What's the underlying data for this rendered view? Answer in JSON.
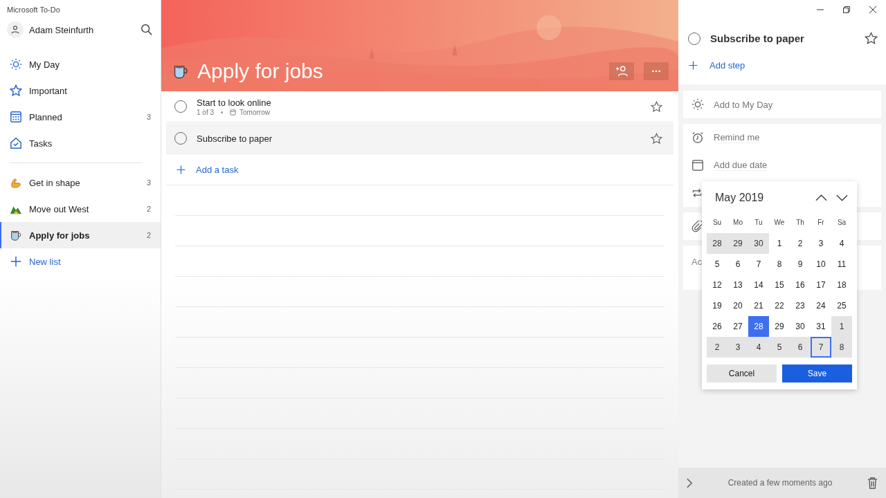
{
  "window": {
    "title": "Microsoft To-Do"
  },
  "user": {
    "name": "Adam Steinfurth"
  },
  "smart_lists": [
    {
      "kind": "sun",
      "label": "My Day",
      "selected": false
    },
    {
      "kind": "star",
      "label": "Important",
      "selected": false
    },
    {
      "kind": "calendar",
      "label": "Planned",
      "count": "3",
      "selected": false
    },
    {
      "kind": "home",
      "label": "Tasks",
      "selected": false
    }
  ],
  "lists": [
    {
      "kind": "arm",
      "label": "Get in shape",
      "count": "3",
      "selected": false
    },
    {
      "kind": "mountain",
      "label": "Move out West",
      "count": "2",
      "selected": false
    },
    {
      "kind": "mug",
      "label": "Apply for jobs",
      "count": "2",
      "selected": true
    }
  ],
  "new_list": "New list",
  "list_title": "Apply for jobs",
  "tasks": [
    {
      "title": "Start to look online",
      "steps": "1 of 3",
      "due": "Tomorrow",
      "completed": false,
      "selected": false
    },
    {
      "title": "Subscribe to paper",
      "completed": false,
      "selected": true
    }
  ],
  "add_task": "Add a task",
  "detail": {
    "title": "Subscribe to paper",
    "completed": false,
    "add_step": "Add step",
    "my_day": "Add to My Day",
    "remind": "Remind me",
    "due_date": "Add due date",
    "note_fragment": "Ac",
    "footer": "Created a few moments ago"
  },
  "calendar": {
    "month": "May 2019",
    "weekdays": [
      "Su",
      "Mo",
      "Tu",
      "We",
      "Th",
      "Fr",
      "Sa"
    ],
    "days": [
      {
        "label": "28",
        "muted": true,
        "selected": false,
        "focused": false
      },
      {
        "label": "29",
        "muted": true,
        "selected": false,
        "focused": false
      },
      {
        "label": "30",
        "muted": true,
        "selected": false,
        "focused": false
      },
      {
        "label": "1",
        "muted": false,
        "selected": false,
        "focused": false
      },
      {
        "label": "2",
        "muted": false,
        "selected": false,
        "focused": false
      },
      {
        "label": "3",
        "muted": false,
        "selected": false,
        "focused": false
      },
      {
        "label": "4",
        "muted": false,
        "selected": false,
        "focused": false
      },
      {
        "label": "5",
        "muted": false,
        "selected": false,
        "focused": false
      },
      {
        "label": "6",
        "muted": false,
        "selected": false,
        "focused": false
      },
      {
        "label": "7",
        "muted": false,
        "selected": false,
        "focused": false
      },
      {
        "label": "8",
        "muted": false,
        "selected": false,
        "focused": false
      },
      {
        "label": "9",
        "muted": false,
        "selected": false,
        "focused": false
      },
      {
        "label": "10",
        "muted": false,
        "selected": false,
        "focused": false
      },
      {
        "label": "11",
        "muted": false,
        "selected": false,
        "focused": false
      },
      {
        "label": "12",
        "muted": false,
        "selected": false,
        "focused": false
      },
      {
        "label": "13",
        "muted": false,
        "selected": false,
        "focused": false
      },
      {
        "label": "14",
        "muted": false,
        "selected": false,
        "focused": false
      },
      {
        "label": "15",
        "muted": false,
        "selected": false,
        "focused": false
      },
      {
        "label": "16",
        "muted": false,
        "selected": false,
        "focused": false
      },
      {
        "label": "17",
        "muted": false,
        "selected": false,
        "focused": false
      },
      {
        "label": "18",
        "muted": false,
        "selected": false,
        "focused": false
      },
      {
        "label": "19",
        "muted": false,
        "selected": false,
        "focused": false
      },
      {
        "label": "20",
        "muted": false,
        "selected": false,
        "focused": false
      },
      {
        "label": "21",
        "muted": false,
        "selected": false,
        "focused": false
      },
      {
        "label": "22",
        "muted": false,
        "selected": false,
        "focused": false
      },
      {
        "label": "23",
        "muted": false,
        "selected": false,
        "focused": false
      },
      {
        "label": "24",
        "muted": false,
        "selected": false,
        "focused": false
      },
      {
        "label": "25",
        "muted": false,
        "selected": false,
        "focused": false
      },
      {
        "label": "26",
        "muted": false,
        "selected": false,
        "focused": false
      },
      {
        "label": "27",
        "muted": false,
        "selected": false,
        "focused": false
      },
      {
        "label": "28",
        "muted": false,
        "selected": true,
        "focused": false
      },
      {
        "label": "29",
        "muted": false,
        "selected": false,
        "focused": false
      },
      {
        "label": "30",
        "muted": false,
        "selected": false,
        "focused": false
      },
      {
        "label": "31",
        "muted": false,
        "selected": false,
        "focused": false
      },
      {
        "label": "1",
        "muted": true,
        "selected": false,
        "focused": false
      },
      {
        "label": "2",
        "muted": true,
        "selected": false,
        "focused": false
      },
      {
        "label": "3",
        "muted": true,
        "selected": false,
        "focused": false
      },
      {
        "label": "4",
        "muted": true,
        "selected": false,
        "focused": false
      },
      {
        "label": "5",
        "muted": true,
        "selected": false,
        "focused": false
      },
      {
        "label": "6",
        "muted": true,
        "selected": false,
        "focused": false
      },
      {
        "label": "7",
        "muted": true,
        "selected": false,
        "focused": true
      },
      {
        "label": "8",
        "muted": true,
        "selected": false,
        "focused": false
      }
    ],
    "cancel": "Cancel",
    "save": "Save"
  }
}
